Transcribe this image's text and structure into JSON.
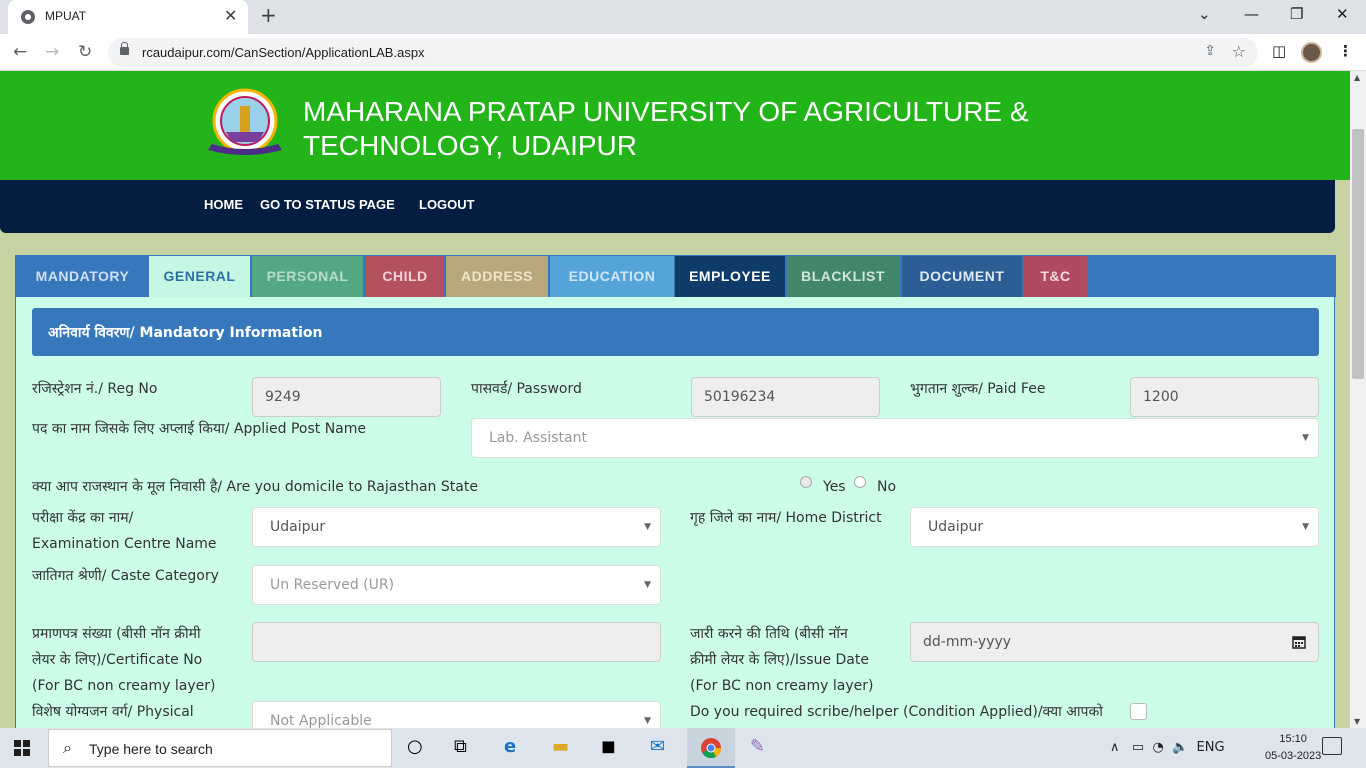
{
  "browser": {
    "tab_title": "MPUAT",
    "url": "rcaudaipur.com/CanSection/ApplicationLAB.aspx"
  },
  "header": {
    "title_line1": "MAHARANA PRATAP UNIVERSITY OF AGRICULTURE &",
    "title_line2": "TECHNOLOGY, UDAIPUR"
  },
  "nav": {
    "home": "HOME",
    "status": "GO TO STATUS PAGE",
    "logout": "LOGOUT"
  },
  "tabs": [
    {
      "label": "MANDATORY",
      "bg": "#3777bc",
      "fg": "#cfe0f2"
    },
    {
      "label": "GENERAL",
      "bg": "#c4f7e4",
      "fg": "#2f6fa5"
    },
    {
      "label": "PERSONAL",
      "bg": "#53a882",
      "fg": "#b6dcc6"
    },
    {
      "label": "CHILD",
      "bg": "#b3515f",
      "fg": "#f2d2d7"
    },
    {
      "label": "ADDRESS",
      "bg": "#b8a77a",
      "fg": "#efe6c9"
    },
    {
      "label": "EDUCATION",
      "bg": "#55a4d7",
      "fg": "#cfe6f5"
    },
    {
      "label": "EMPLOYEE",
      "bg": "#0e3b68",
      "fg": "#ffffff"
    },
    {
      "label": "BLACKLIST",
      "bg": "#43876a",
      "fg": "#cde6d9"
    },
    {
      "label": "DOCUMENT",
      "bg": "#2c5e95",
      "fg": "#e0e9f3"
    },
    {
      "label": "T&C",
      "bg": "#b04a5e",
      "fg": "#f6dbe0"
    }
  ],
  "section_title": "अनिवार्य विवरण/ Mandatory Information",
  "form": {
    "reg_label": "रजिस्ट्रेशन नं./ Reg No",
    "reg_value": "9249",
    "pwd_label": "पासवर्ड/ Password",
    "pwd_value": "50196234",
    "fee_label": "भुगतान शुल्क/ Paid Fee",
    "fee_value": "1200",
    "post_label": "पद का नाम जिसके लिए अप्लाई किया/ Applied Post Name",
    "post_value": "Lab. Assistant",
    "domicile_label": "क्या आप राजस्थान के मूल निवासी है/ Are you domicile to Rajasthan State",
    "yes": "Yes",
    "no": "No",
    "centre_label1": "परीक्षा केंद्र का नाम/",
    "centre_label2": "Examination Centre Name",
    "centre_value": "Udaipur",
    "district_label": "गृह जिले का नाम/ Home District",
    "district_value": "Udaipur",
    "caste_label": "जातिगत श्रेणी/ Caste Category",
    "caste_value": "Un Reserved (UR)",
    "cert_label1": "प्रमाणपत्र संख्या (बीसी नॉन क्रीमी",
    "cert_label2": "लेयर के लिए)/Certificate No",
    "cert_label3": "(For BC non creamy layer)",
    "issue_label1": "जारी करने की तिथि (बीसी नॉन",
    "issue_label2": "क्रीमी लेयर के लिए)/Issue Date",
    "issue_label3": "(For BC non creamy layer)",
    "issue_placeholder": "dd-mm-yyyy",
    "special_label": "विशेष योग्यजन वर्ग/ Physical",
    "special_value": "Not Applicable",
    "scribe_label": "Do you required scribe/helper (Condition Applied)/क्या आपको"
  },
  "taskbar": {
    "search": "Type here to search",
    "lang": "ENG",
    "time": "15:10",
    "date": "05-03-2023"
  }
}
